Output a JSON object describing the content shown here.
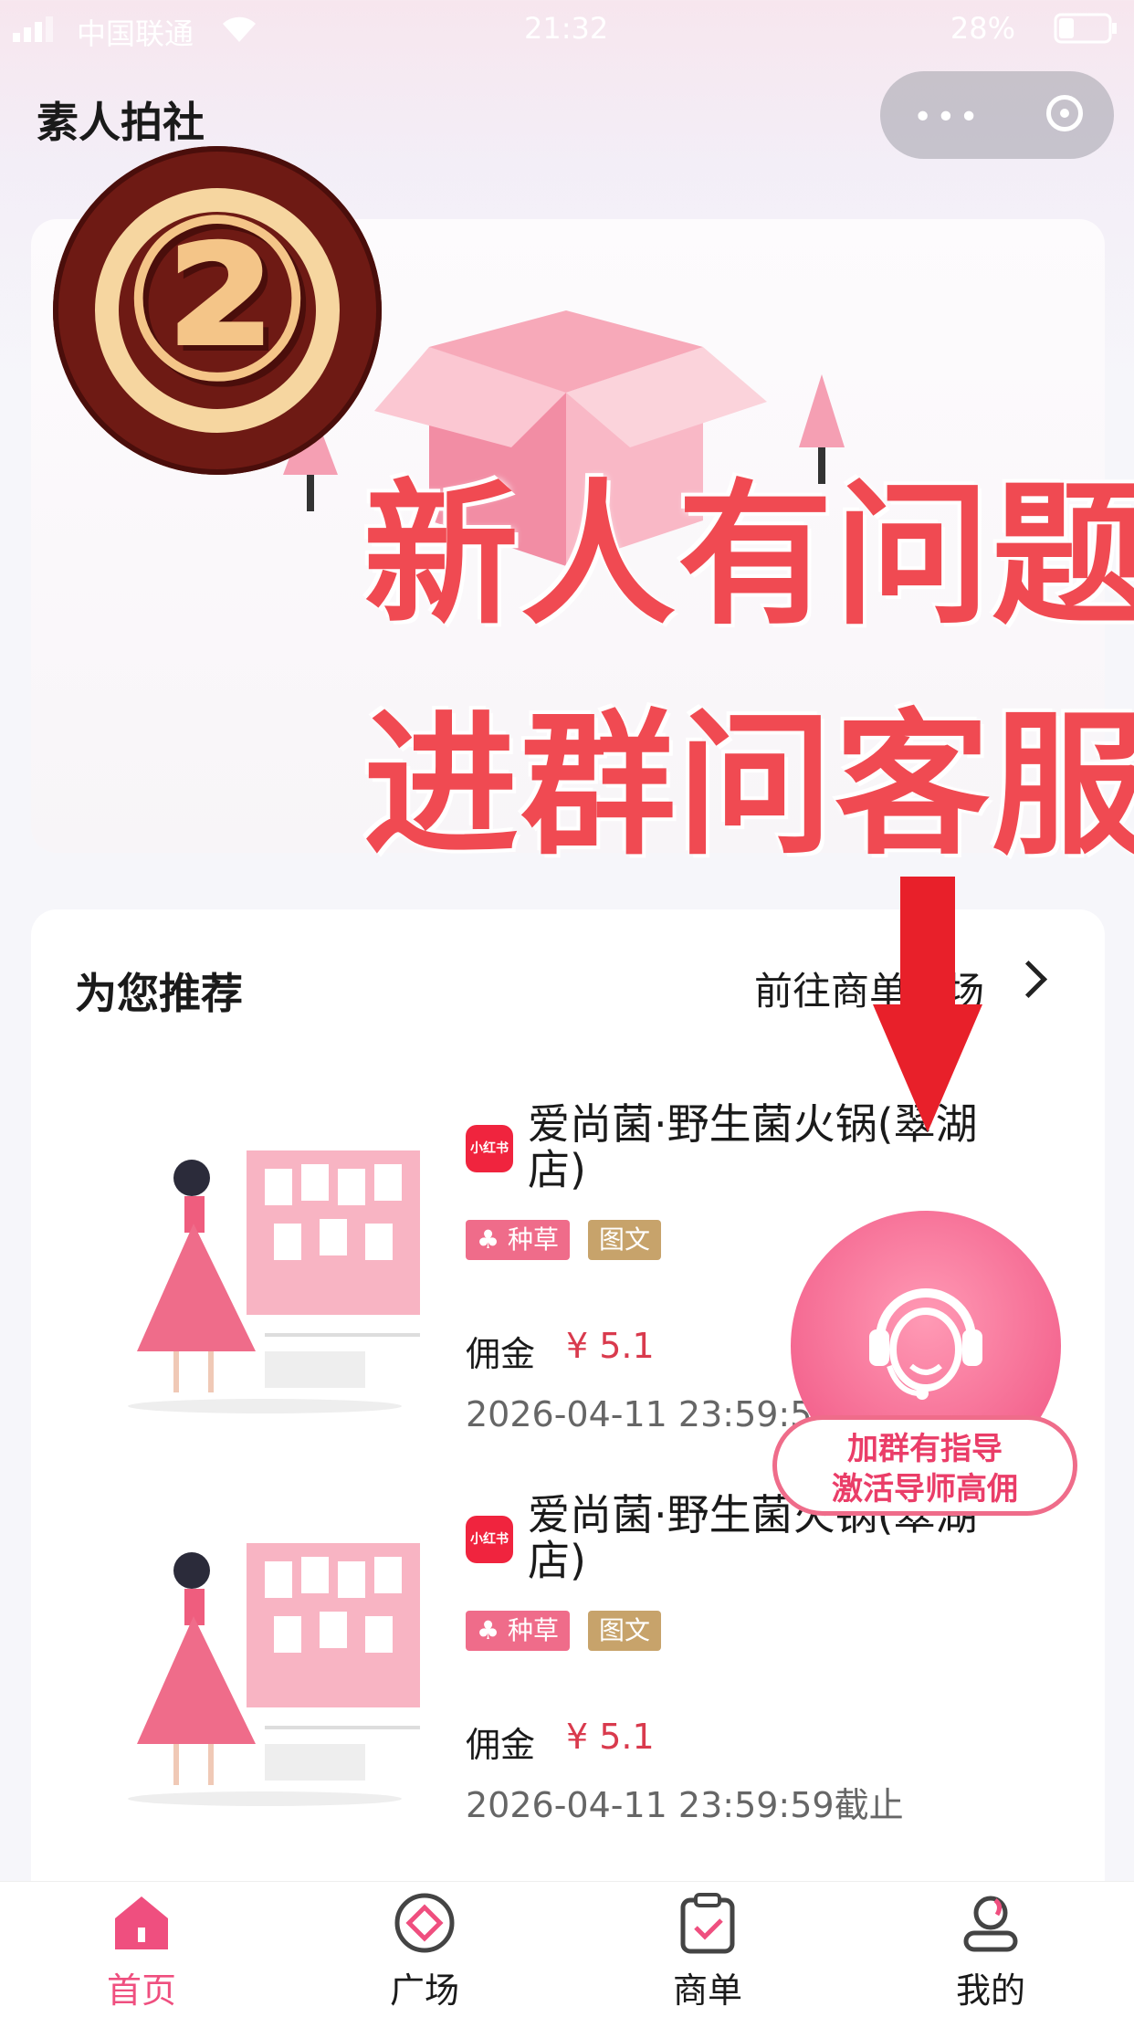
{
  "status_bar": {
    "carrier": "中国联通",
    "time": "21:32",
    "battery": "28%"
  },
  "header": {
    "app_title": "素人拍社"
  },
  "overlay": {
    "badge": "②",
    "line1": "新人有问题",
    "line2": "进群问客服"
  },
  "recommend": {
    "title": "为您推荐",
    "more": "前往商单广场",
    "items": [
      {
        "source": "小红书",
        "name": "爱尚菌·野生菌火锅(翠湖店)",
        "tags": [
          "种草",
          "图文"
        ],
        "commission_label": "佣金",
        "commission": "¥ 5.1",
        "deadline": "2026-04-11 23:59:59截止"
      },
      {
        "source": "小红书",
        "name": "爱尚菌·野生菌火锅(翠湖店)",
        "tags": [
          "种草",
          "图文"
        ],
        "commission_label": "佣金",
        "commission": "¥ 5.1",
        "deadline": "2026-04-11 23:59:59截止"
      }
    ]
  },
  "float_cs": {
    "line1": "加群有指导",
    "line2": "激活导师高佣"
  },
  "tabbar": {
    "active_color": "#ef4f7f",
    "tabs": [
      {
        "label": "首页",
        "icon": "home-icon",
        "active": true
      },
      {
        "label": "广场",
        "icon": "square-icon",
        "active": false
      },
      {
        "label": "商单",
        "icon": "order-icon",
        "active": false
      },
      {
        "label": "我的",
        "icon": "profile-icon",
        "active": false
      }
    ]
  }
}
